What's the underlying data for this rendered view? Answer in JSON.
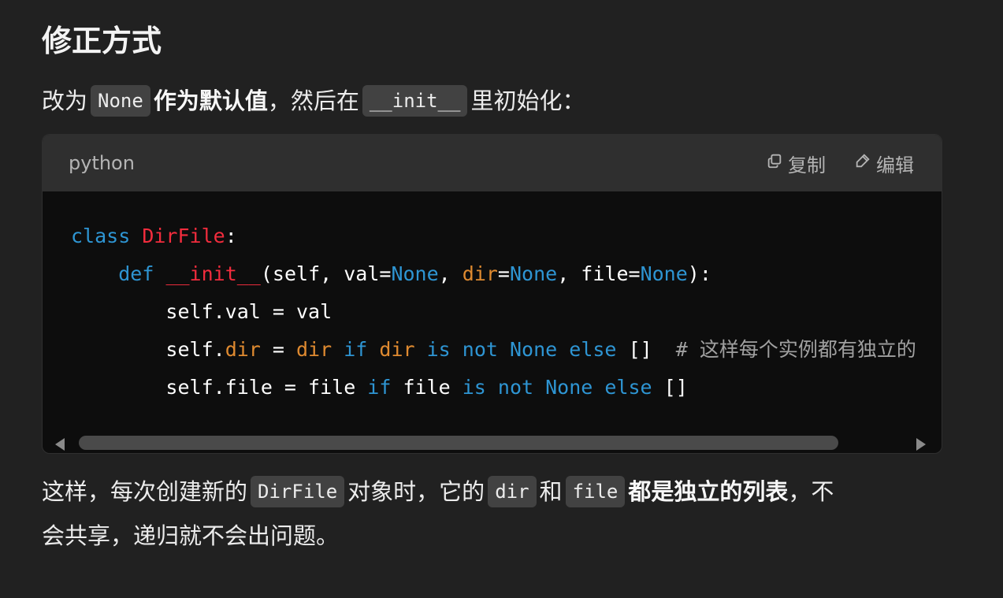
{
  "heading": "修正方式",
  "para1": {
    "t1": "改为",
    "code1": "None",
    "strong": "作为默认值",
    "t2": "，然后在",
    "code2": "__init__",
    "t3": "里初始化："
  },
  "codeblock": {
    "lang": "python",
    "copy_label": "复制",
    "edit_label": "编辑",
    "icons": {
      "copy": "copy-icon",
      "edit": "pencil-icon"
    },
    "colors": {
      "keyword": "#2e95d3",
      "class_name": "#f22c3d",
      "param": "#df8a30",
      "comment": "#a0a0a0"
    },
    "line1": {
      "kw_class": "class",
      "name": "DirFile",
      "colon": ":"
    },
    "line2": {
      "kw_def": "def",
      "fn": "__init__",
      "p_open": "(self, val=",
      "none1": "None",
      "comma1": ", ",
      "p_dir": "dir",
      "eq1": "=",
      "none2": "None",
      "p_file": ", file=",
      "none3": "None",
      "close": "):"
    },
    "line3": "self.val = val",
    "line4": {
      "a": "self.",
      "b": "dir",
      "c": " = ",
      "d": "dir",
      "e": "if",
      "f": "dir",
      "g": "is",
      "h": "not",
      "i": "None",
      "j": "else",
      "k": "[]",
      "comment": "# 这样每个实例都有独立的"
    },
    "line5": {
      "a": "self.file = file ",
      "b": "if",
      "c": " file ",
      "d": "is",
      "e": "not",
      "f": "None",
      "g": "else",
      "h": " []"
    }
  },
  "para2": {
    "t1": "这样，每次创建新的",
    "code1": "DirFile",
    "t2": "对象时，它的",
    "code2": "dir",
    "t3": "和",
    "code3": "file",
    "strong": "都是独立的列表",
    "t4": "，不"
  },
  "para3": "会共享，递归就不会出问题。"
}
